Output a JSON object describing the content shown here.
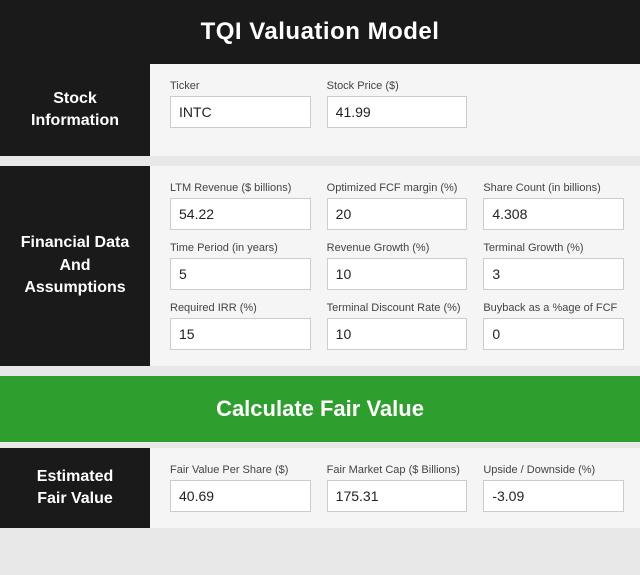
{
  "header": {
    "title": "TQI Valuation Model"
  },
  "stock_section": {
    "label": "Stock\nInformation",
    "fields": [
      {
        "label": "Ticker",
        "value": "INTC",
        "id": "ticker"
      },
      {
        "label": "Stock Price ($)",
        "value": "41.99",
        "id": "stock-price"
      }
    ]
  },
  "financial_section": {
    "label": "Financial Data\nAnd\nAssumptions",
    "rows": [
      [
        {
          "label": "LTM Revenue ($ billions)",
          "value": "54.22",
          "id": "ltm-revenue"
        },
        {
          "label": "Optimized FCF margin (%)",
          "value": "20",
          "id": "fcf-margin"
        },
        {
          "label": "Share Count (in billions)",
          "value": "4.308",
          "id": "share-count"
        }
      ],
      [
        {
          "label": "Time Period (in years)",
          "value": "5",
          "id": "time-period"
        },
        {
          "label": "Revenue Growth (%)",
          "value": "10",
          "id": "revenue-growth"
        },
        {
          "label": "Terminal Growth (%)",
          "value": "3",
          "id": "terminal-growth"
        }
      ],
      [
        {
          "label": "Required IRR (%)",
          "value": "15",
          "id": "required-irr"
        },
        {
          "label": "Terminal Discount Rate (%)",
          "value": "10",
          "id": "terminal-discount"
        },
        {
          "label": "Buyback as a %age of FCF",
          "value": "0",
          "id": "buyback-pct"
        }
      ]
    ]
  },
  "calculate_button": {
    "label": "Calculate Fair Value"
  },
  "results_section": {
    "label": "Estimated\nFair Value",
    "fields": [
      {
        "label": "Fair Value Per Share ($)",
        "value": "40.69",
        "id": "fair-value-share"
      },
      {
        "label": "Fair Market Cap ($ Billions)",
        "value": "175.31",
        "id": "fair-market-cap"
      },
      {
        "label": "Upside / Downside (%)",
        "value": "-3.09",
        "id": "upside-downside"
      }
    ]
  }
}
